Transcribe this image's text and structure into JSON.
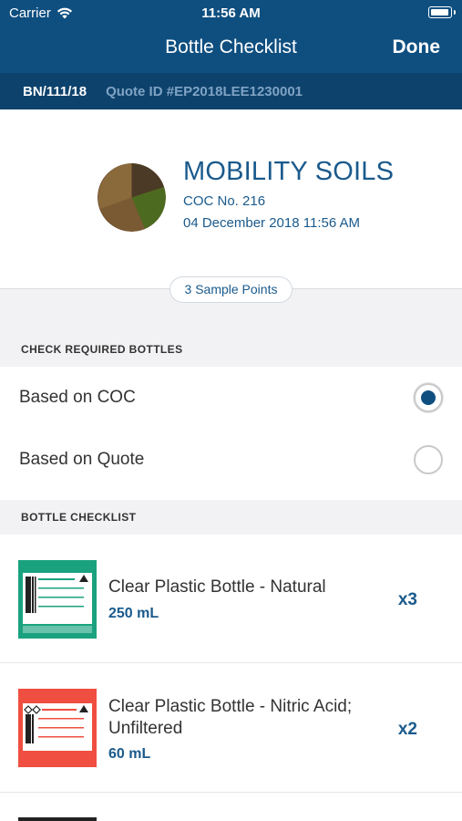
{
  "status": {
    "carrier": "Carrier",
    "time": "11:56 AM"
  },
  "nav": {
    "title": "Bottle Checklist",
    "done_label": "Done"
  },
  "subheader": {
    "batch_number": "BN/111/18",
    "quote_id": "Quote ID #EP2018LEE1230001"
  },
  "customer": {
    "name": "MOBILITY SOILS",
    "coc": "COC No. 216",
    "date": "04 December 2018 11:56 AM",
    "sample_points": "3 Sample Points"
  },
  "required_bottles": {
    "header": "CHECK REQUIRED BOTTLES",
    "options": [
      {
        "label": "Based on COC",
        "checked": true
      },
      {
        "label": "Based on Quote",
        "checked": false
      }
    ]
  },
  "checklist": {
    "header": "BOTTLE CHECKLIST",
    "items": [
      {
        "name": "Clear Plastic Bottle - Natural",
        "volume": "250 mL",
        "quantity": "x3",
        "label_color": "#1aa27f",
        "icon": "bottle-label-green"
      },
      {
        "name": "Clear Plastic Bottle - Nitric Acid; Unfiltered",
        "volume": "60 mL",
        "quantity": "x2",
        "label_color": "#ef4e40",
        "icon": "bottle-label-red"
      }
    ]
  },
  "colors": {
    "brand": "#0f4f80",
    "accent_text": "#1a5a8c"
  }
}
